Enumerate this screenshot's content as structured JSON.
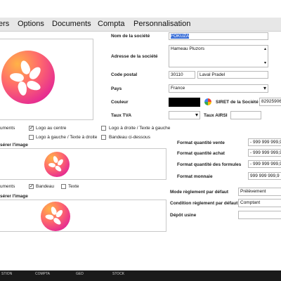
{
  "menu": [
    "ers",
    "Options",
    "Documents",
    "Compta",
    "Personnalisation"
  ],
  "left": {
    "placement_label_1": "uments",
    "logo_center_label": "Logo au centre",
    "logo_right_label": "Logo à droite / Texte à gauche",
    "logo_left_label": "Logo à gauche / Texte à droite",
    "banner_below_label": "Bandeau ci-dessous",
    "insert_image_1": "sérer l'image",
    "placement_label_2": "uments",
    "banner_label": "Bandeau",
    "text_label": "Texte",
    "insert_image_2": "sérer l'image"
  },
  "form": {
    "company_name_label": "Nom de la société",
    "company_name": "FOKUZA",
    "address_label": "Adresse de la société",
    "address": "Hameau Pluzors",
    "postal_label": "Code postal",
    "postal_code": "30110",
    "city": "Laval Pradel",
    "country_label": "Pays",
    "country": "France",
    "color_label": "Couleur",
    "siret_label": "SIRET de la Société",
    "siret": "82925906",
    "tva_label": "Taux TVA",
    "airsi_label": "Taux AIRSI",
    "fmt_qty_sale_label": "Format quantité vente",
    "fmt_qty_sale": "- 999 999 999,9",
    "fmt_qty_buy_label": "Format quantité achat",
    "fmt_qty_buy": "- 999 999 999,9",
    "fmt_qty_formula_label": "Format quantité des formules",
    "fmt_qty_formula": "- 999 999 999,9",
    "fmt_money_label": "Format monnaie",
    "fmt_money": "999 999 999,9",
    "payment_mode_label": "Mode règlement par défaut",
    "payment_mode": "Prélèvement",
    "payment_cond_label": "Condition règlement par défaut",
    "payment_cond": "Comptant",
    "deposit_label": "Dépôt usine"
  },
  "taskbar": [
    "STION",
    "COMPTA",
    "GED",
    "STOCK"
  ],
  "colors": {
    "accent_pink": "#e8318f",
    "selection": "#3a6fd8",
    "swatch": "#000000"
  }
}
